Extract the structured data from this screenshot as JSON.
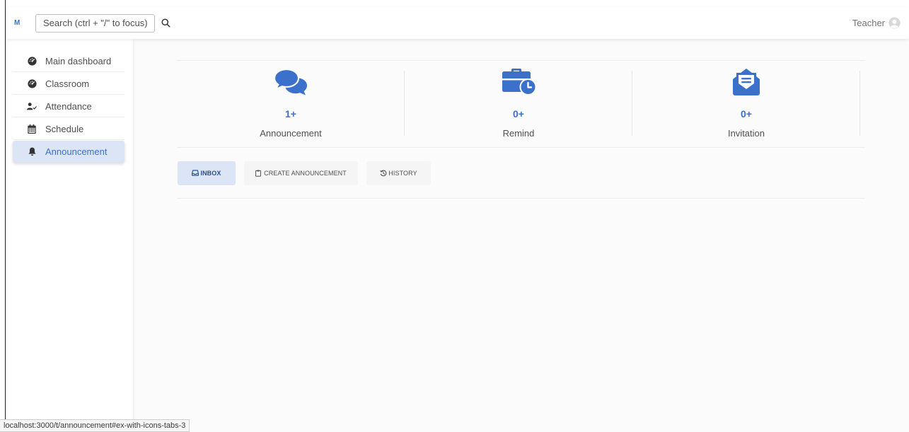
{
  "navbar": {
    "logo_text": "M",
    "search_placeholder": "Search (ctrl + \"/\" to focus)",
    "user_name": "Teacher"
  },
  "sidebar": {
    "items": [
      {
        "label": "Main dashboard",
        "icon": "tachometer-icon"
      },
      {
        "label": "Classroom",
        "icon": "tachometer-icon"
      },
      {
        "label": "Attendance",
        "icon": "user-check-icon"
      },
      {
        "label": "Schedule",
        "icon": "calendar-icon"
      },
      {
        "label": "Announcement",
        "icon": "bell-icon",
        "active": true
      }
    ]
  },
  "stats": [
    {
      "count": "1+",
      "label": "Announcement",
      "icon": "comments-icon"
    },
    {
      "count": "0+",
      "label": "Remind",
      "icon": "business-time-icon"
    },
    {
      "count": "0+",
      "label": "Invitation",
      "icon": "envelope-open-text-icon"
    }
  ],
  "tabs": [
    {
      "label": "INBOX",
      "icon": "inbox-icon",
      "active": true
    },
    {
      "label": "CREATE ANNOUNCEMENT",
      "icon": "clipboard-icon"
    },
    {
      "label": "HISTORY",
      "icon": "history-icon"
    }
  ],
  "status_bar": {
    "url": "localhost:3000/t/announcement#ex-with-icons-tabs-3"
  },
  "colors": {
    "accent": "#3b71ca",
    "active_bg": "#dbe5f6"
  }
}
